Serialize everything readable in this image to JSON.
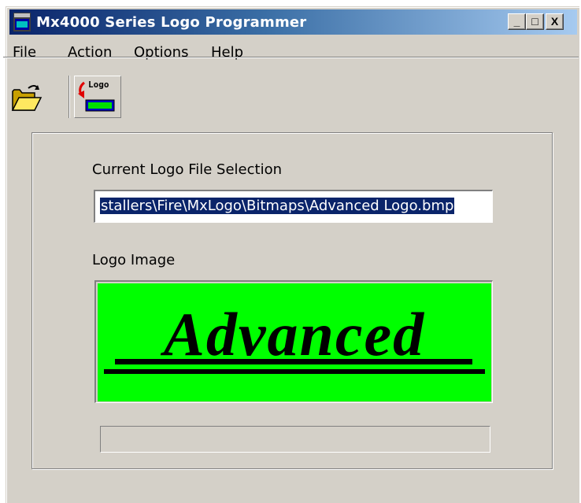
{
  "window": {
    "title": "Mx4000 Series Logo Programmer",
    "controls": {
      "minimize": "_",
      "maximize": "□",
      "close": "X"
    }
  },
  "menu": {
    "items": [
      {
        "label": "File",
        "accel": "F",
        "rest": "ile"
      },
      {
        "label": "Action",
        "accel": "A",
        "rest": "ction"
      },
      {
        "label": "Options",
        "accel": "O",
        "rest": "ptions"
      },
      {
        "label": "Help",
        "accel": "H",
        "rest": "elp"
      }
    ]
  },
  "toolbar": {
    "open_icon": "open-folder-icon",
    "logo_icon": "logo-program-icon",
    "logo_icon_text": "Logo"
  },
  "main": {
    "file_label": "Current Logo File Selection",
    "file_value": "stallers\\Fire\\MxLogo\\Bitmaps\\Advanced Logo.bmp",
    "image_label": "Logo Image",
    "logo_text": "Advanced",
    "logo_bg_color": "#00ff00",
    "progress": 0
  }
}
